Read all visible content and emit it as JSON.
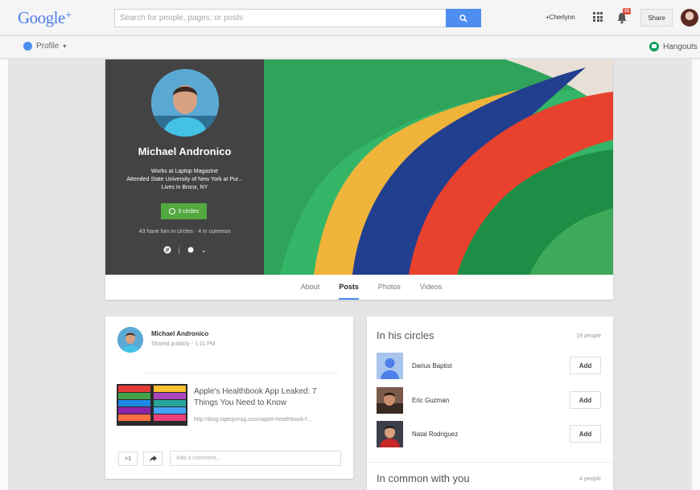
{
  "header": {
    "logo": "Google",
    "logo_plus": "+",
    "search_placeholder": "Search for people, pages, or posts",
    "user_link": "+Cherlynn",
    "notification_count": "11",
    "share_label": "Share"
  },
  "subbar": {
    "profile_label": "Profile",
    "hangouts_label": "Hangouts"
  },
  "profile": {
    "name": "Michael Andronico",
    "info_lines": [
      "Works at Laptop Magazine",
      "Attended State University of New York at Pur...",
      "Lives in Bronx, NY"
    ],
    "circles_button": "3 circles",
    "circles_text": "43 have him in circles · 4 in common"
  },
  "tabs": [
    {
      "label": "About",
      "active": false
    },
    {
      "label": "Posts",
      "active": true
    },
    {
      "label": "Photos",
      "active": false
    },
    {
      "label": "Videos",
      "active": false
    }
  ],
  "post": {
    "author": "Michael Andronico",
    "meta": "Shared publicly  -  1:11 PM",
    "link_title": "Apple's Healthbook App Leaked: 7 Things You Need to Know",
    "link_url": "http://blog.laptopmag.com/apple-healthbook-f...",
    "plus_one": "+1",
    "comment_placeholder": "Add a comment..."
  },
  "circles_card": {
    "title": "In his circles",
    "count": "19 people",
    "people": [
      {
        "name": "Darius Baptist",
        "add_label": "Add"
      },
      {
        "name": "Eric Guzman",
        "add_label": "Add"
      },
      {
        "name": "Natal Rodriguez",
        "add_label": "Add"
      }
    ],
    "common_title": "In common with you",
    "common_count": "4 people"
  },
  "colors": {
    "accent": "#4d8ef0",
    "panel": "#434343",
    "circles_green": "#53a93f",
    "notification_red": "#dd4b39"
  }
}
